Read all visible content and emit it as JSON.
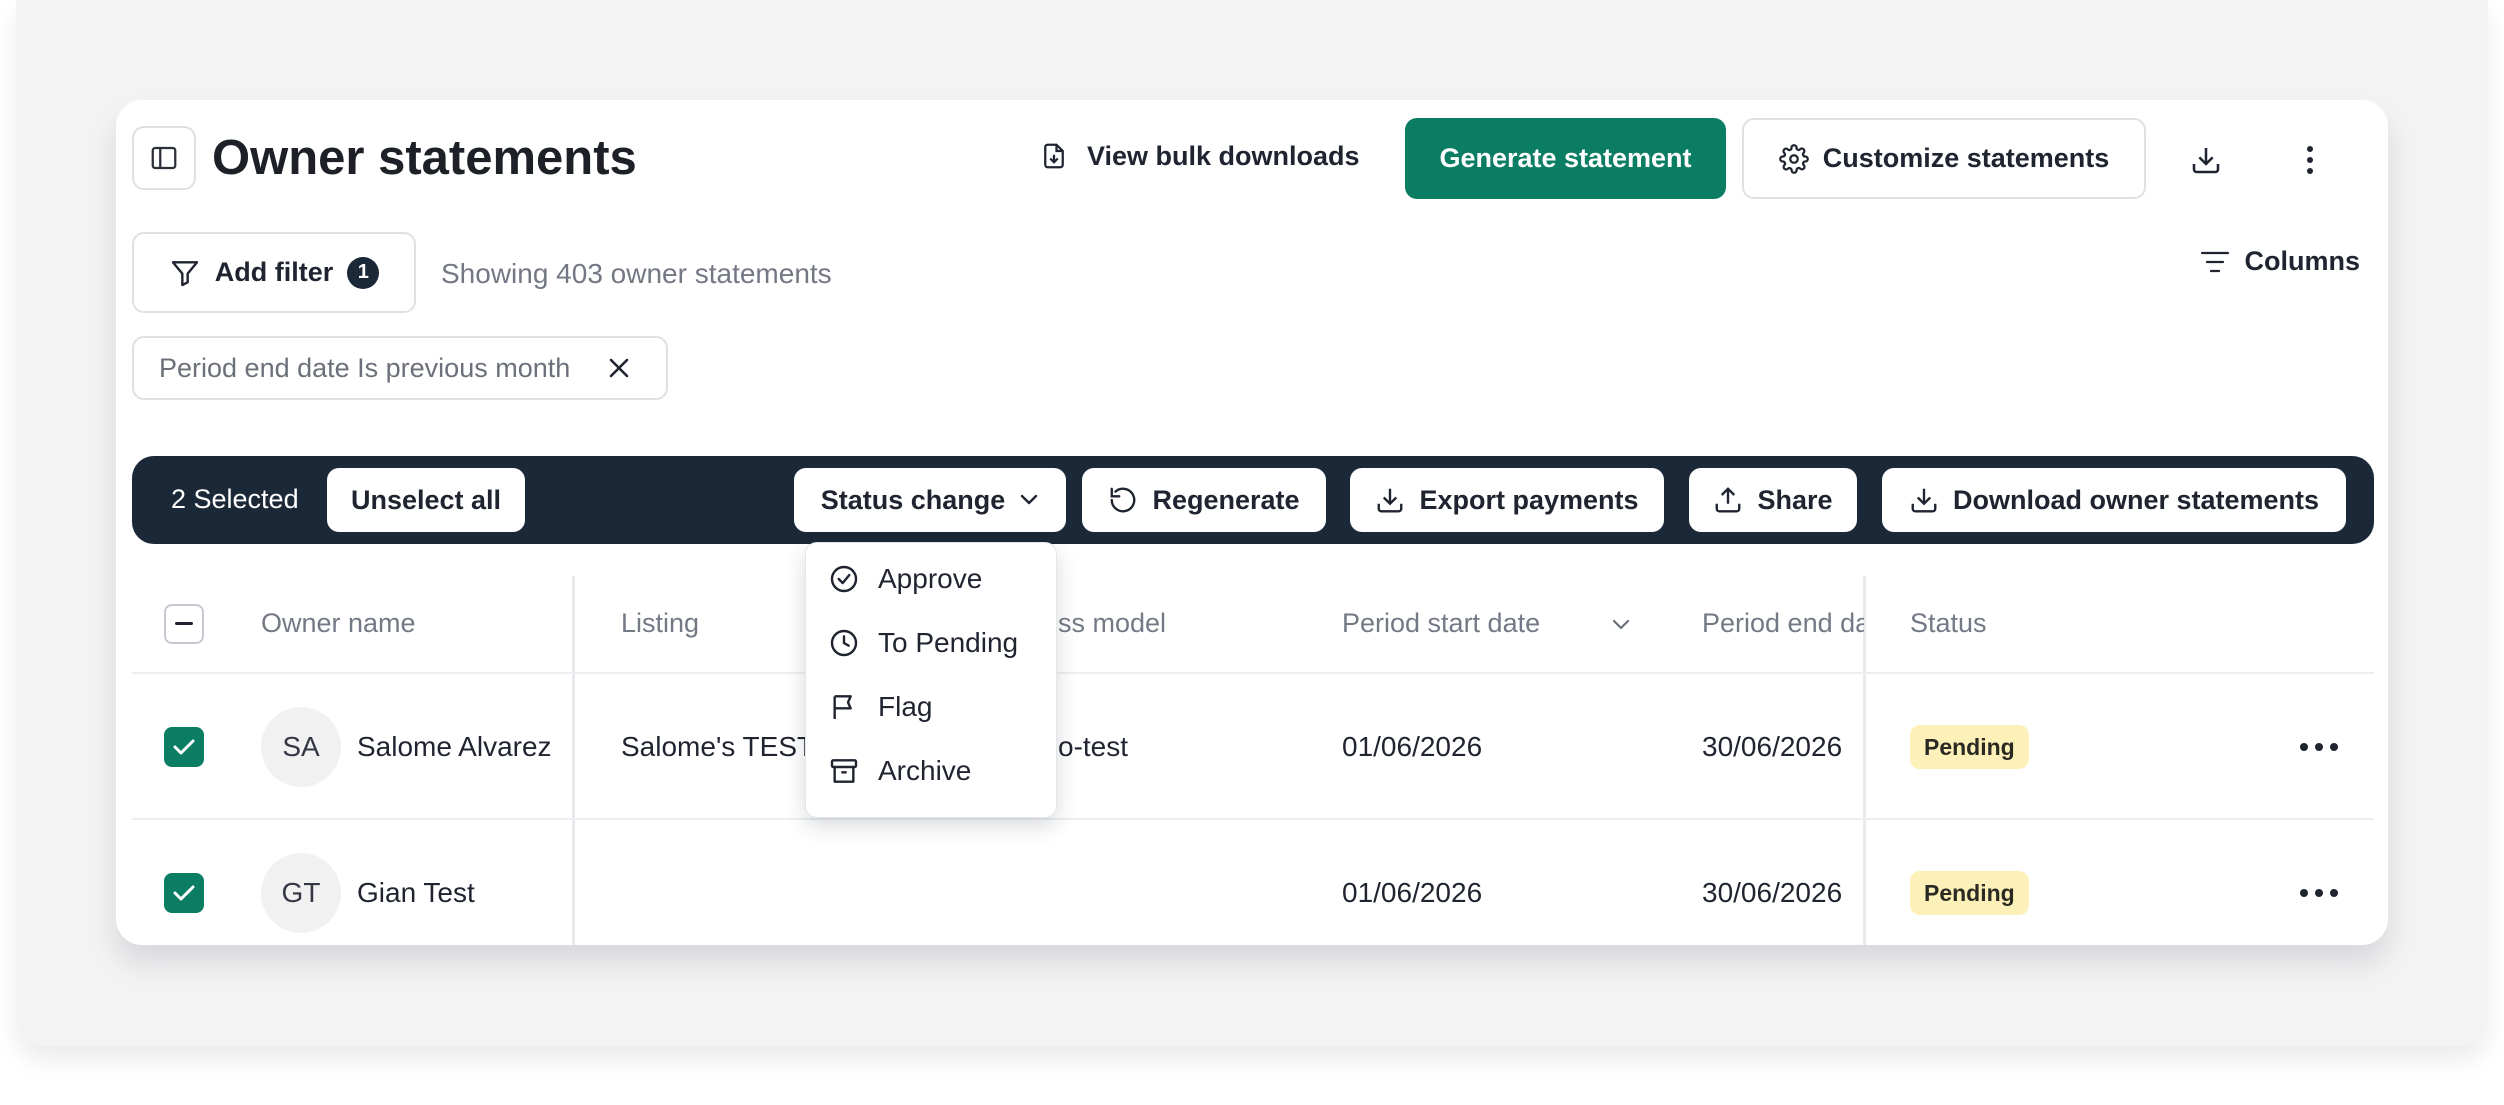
{
  "header": {
    "title": "Owner statements",
    "view_bulk": "View bulk downloads",
    "generate": "Generate statement",
    "customize": "Customize statements"
  },
  "filters": {
    "add_filter": "Add filter",
    "filter_count": "1",
    "showing": "Showing 403 owner statements",
    "columns": "Columns",
    "chip": "Period end date Is previous month"
  },
  "bulk_bar": {
    "selected": "2 Selected",
    "unselect": "Unselect all",
    "status_change": "Status change",
    "regenerate": "Regenerate",
    "export": "Export payments",
    "share": "Share",
    "download": "Download owner statements"
  },
  "status_menu": [
    "Approve",
    "To Pending",
    "Flag",
    "Archive"
  ],
  "table": {
    "columns": {
      "owner": "Owner name",
      "listing": "Listing",
      "model": "ss model",
      "start": "Period start date",
      "end": "Period end dat",
      "status": "Status"
    },
    "rows": [
      {
        "initials": "SA",
        "owner": "Salome Alvarez",
        "listing": "Salome's TEST",
        "model": "o-test",
        "start": "01/06/2026",
        "end": "30/06/2026",
        "status": "Pending"
      },
      {
        "initials": "GT",
        "owner": "Gian Test",
        "listing": "",
        "model": "",
        "start": "01/06/2026",
        "end": "30/06/2026",
        "status": "Pending"
      }
    ]
  },
  "colors": {
    "primary": "#0b7d63",
    "bulk_bar": "#1b2838",
    "pending_badge": "#fdf0b8"
  }
}
